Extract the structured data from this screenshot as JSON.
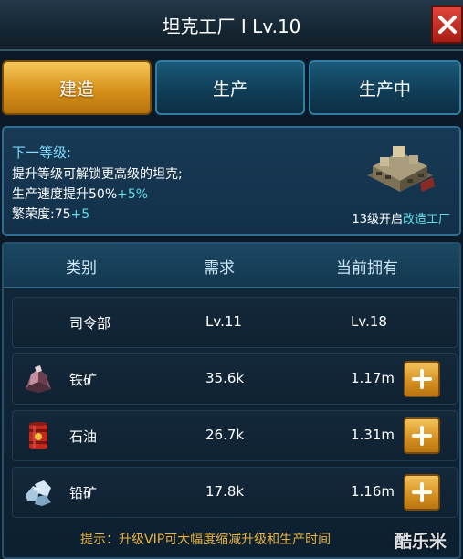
{
  "header": {
    "title": "坦克工厂 I Lv.10"
  },
  "tabs": [
    {
      "label": "建造",
      "active": true
    },
    {
      "label": "生产",
      "active": false
    },
    {
      "label": "生产中",
      "active": false
    }
  ],
  "info": {
    "heading": "下一等级:",
    "line1": "提升等级可解锁更高级的坦克;",
    "line2_base": "生产速度提升50%",
    "line2_bonus": "+5%",
    "line3_base": "繁荣度:75",
    "line3_bonus": "+5",
    "unlock_prefix": "13级开启",
    "unlock_link": "改造工厂"
  },
  "table": {
    "columns": [
      "类别",
      "需求",
      "当前拥有"
    ],
    "rows": [
      {
        "name": "司令部",
        "required": "Lv.11",
        "owned": "Lv.18",
        "icon": "none",
        "has_plus": false
      },
      {
        "name": "铁矿",
        "required": "35.6k",
        "owned": "1.17m",
        "icon": "iron-ore-icon",
        "has_plus": true
      },
      {
        "name": "石油",
        "required": "26.7k",
        "owned": "1.31m",
        "icon": "oil-barrel-icon",
        "has_plus": true
      },
      {
        "name": "铅矿",
        "required": "17.8k",
        "owned": "1.16m",
        "icon": "lead-ore-icon",
        "has_plus": true
      }
    ]
  },
  "hint": "提示：升级VIP可大幅度缩减升级和生产时间",
  "watermark": "酷乐米",
  "colors": {
    "accent_gold": "#d7911a",
    "tab_blue": "#0f3c55",
    "bonus_cyan": "#5ee0e8",
    "hint_gold": "#e9b340",
    "close_red": "#c0291f"
  }
}
